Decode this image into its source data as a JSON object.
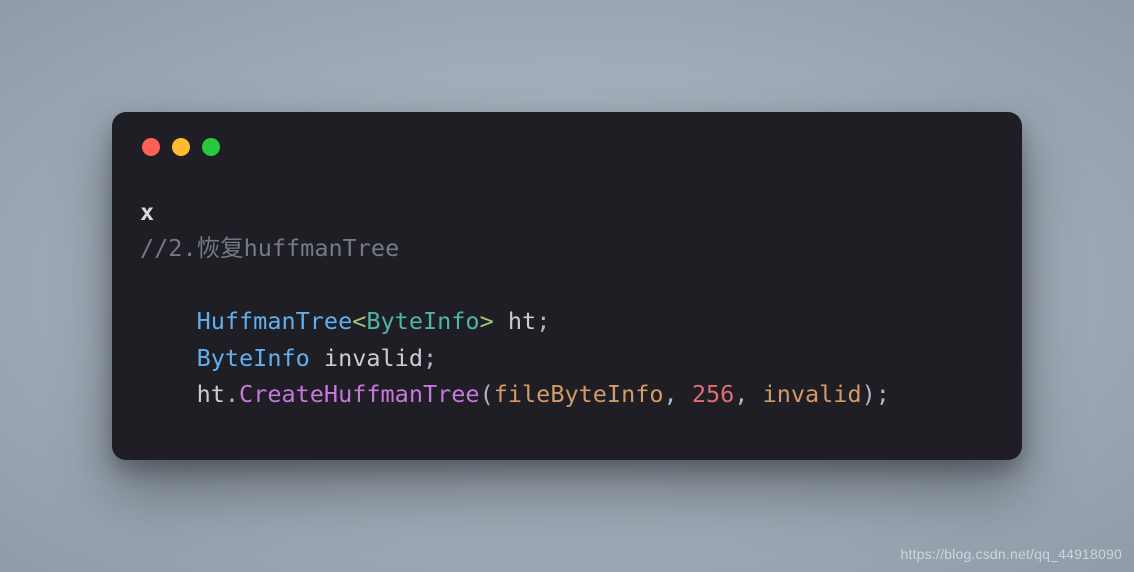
{
  "code": {
    "line1": "x",
    "comment": "//2.恢复huffmanTree",
    "huffman_type": "HuffmanTree",
    "lt": "<",
    "byteinfo": "ByteInfo",
    "gt": ">",
    "ht": " ht",
    "semi": ";",
    "byteinfo2": "ByteInfo",
    "invalid_decl": " invalid",
    "ht2": "ht",
    "dot": ".",
    "method": "CreateHuffmanTree",
    "open": "(",
    "arg1": "fileByteInfo",
    "comma1": ", ",
    "arg2_num": "256",
    "comma2": ", ",
    "arg3": "invalid",
    "close": ")",
    "indent": "    "
  },
  "watermark": "https://blog.csdn.net/qq_44918090"
}
